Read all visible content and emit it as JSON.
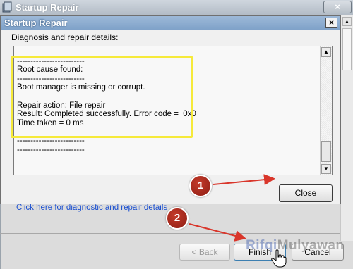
{
  "outer_window": {
    "title": "Startup Repair"
  },
  "dialog": {
    "title": "Startup Repair",
    "close_glyph": "×",
    "details_label": "Diagnosis and repair details:",
    "details_text": "\n-------------------------\nRoot cause found:\n-------------------------\nBoot manager is missing or corrupt.\n\nRepair action: File repair\nResult: Completed successfully. Error code =  0x0\nTime taken = 0 ms\n\n-------------------------\n-------------------------",
    "close_button_label": "Close"
  },
  "footer": {
    "diagnostic_link": "Click here for diagnostic and repair details",
    "back_label": "< Back",
    "finish_label": "Finish",
    "cancel_label": "Cancel"
  },
  "annotations": {
    "marker_1": "1",
    "marker_2": "2",
    "highlight_color": "#f6ea3a",
    "arrow_color": "#d9362b"
  },
  "watermark": {
    "part1": "Rifqi",
    "part2": "Mulyawan"
  }
}
